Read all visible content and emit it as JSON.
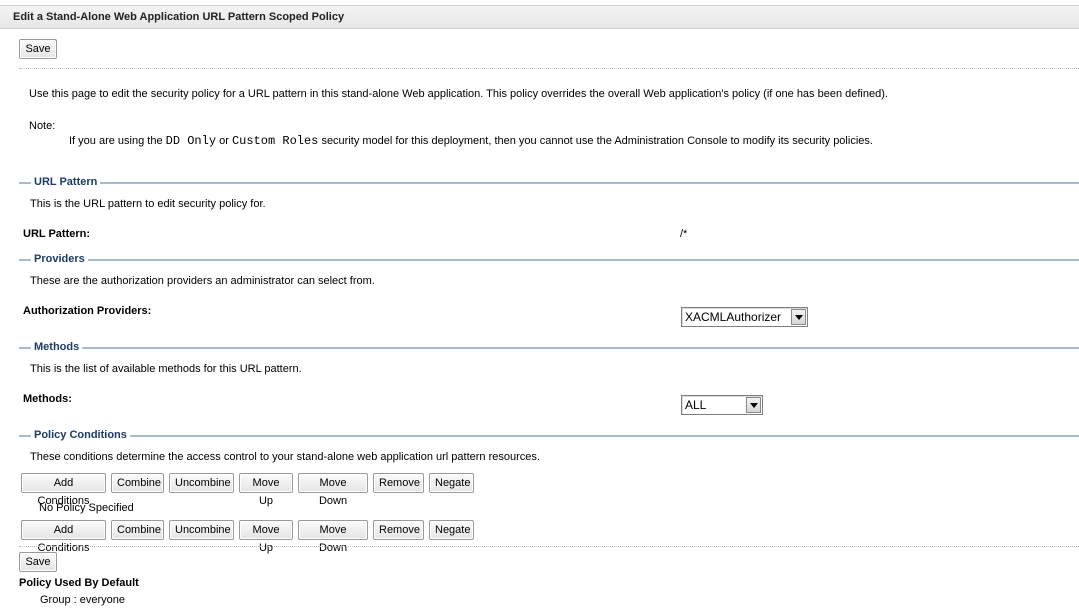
{
  "page_title": "Edit a Stand-Alone Web Application URL Pattern Scoped Policy",
  "buttons": {
    "save": "Save"
  },
  "intro": {
    "text": "Use this page to edit the security policy for a URL pattern in this stand-alone Web application. This policy overrides the overall Web application's policy (if one has been defined).",
    "note_label": "Note:",
    "note_prefix": "If you are using the",
    "note_dd_only": "DD Only",
    "note_or": "or",
    "note_custom_roles": "Custom Roles",
    "note_suffix": "security model for this deployment, then you cannot use the Administration Console to modify its security policies."
  },
  "url_pattern": {
    "section_label": "URL Pattern",
    "description": "This is the URL pattern to edit security policy for.",
    "field_label": "URL Pattern:",
    "value": "/*"
  },
  "providers": {
    "section_label": "Providers",
    "description": "These are the authorization providers an administrator can select from.",
    "field_label": "Authorization Providers:",
    "selected": "XACMLAuthorizer"
  },
  "methods": {
    "section_label": "Methods",
    "description": "This is the list of available methods for this URL pattern.",
    "field_label": "Methods:",
    "selected": "ALL"
  },
  "policy_conditions": {
    "section_label": "Policy Conditions",
    "description": "These conditions determine the access control to your stand-alone web application url pattern resources.",
    "toolbar": {
      "add_conditions": "Add Conditions",
      "combine": "Combine",
      "uncombine": "Uncombine",
      "move_up": "Move Up",
      "move_down": "Move Down",
      "remove": "Remove",
      "negate": "Negate"
    },
    "empty_text": "No Policy Specified"
  },
  "default_policy": {
    "label": "Policy Used By Default",
    "value": "Group : everyone"
  }
}
